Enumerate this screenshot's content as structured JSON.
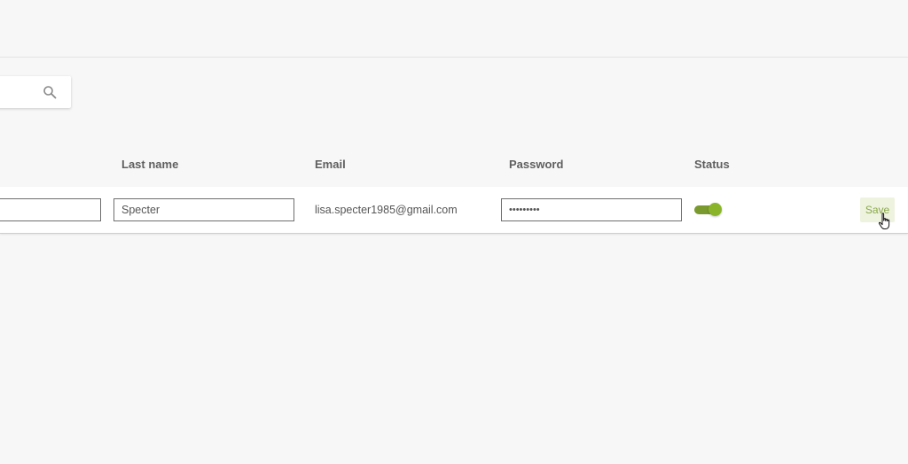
{
  "search": {
    "value": "",
    "placeholder": "",
    "icon": "search-icon"
  },
  "table": {
    "columns": [
      "Last name",
      "Email",
      "Password",
      "Status"
    ],
    "row": {
      "first_name": "",
      "last_name": "Specter",
      "email": "lisa.specter1985@gmail.com",
      "password": "•••••••••",
      "status_on": true,
      "save_label": "Save"
    }
  },
  "colors": {
    "toggle_track": "#7a9a2f",
    "toggle_knob": "#8ab52a",
    "save_bg": "#eef3e0",
    "save_text": "#8aa84a"
  },
  "cursor": "hand-pointer-icon"
}
